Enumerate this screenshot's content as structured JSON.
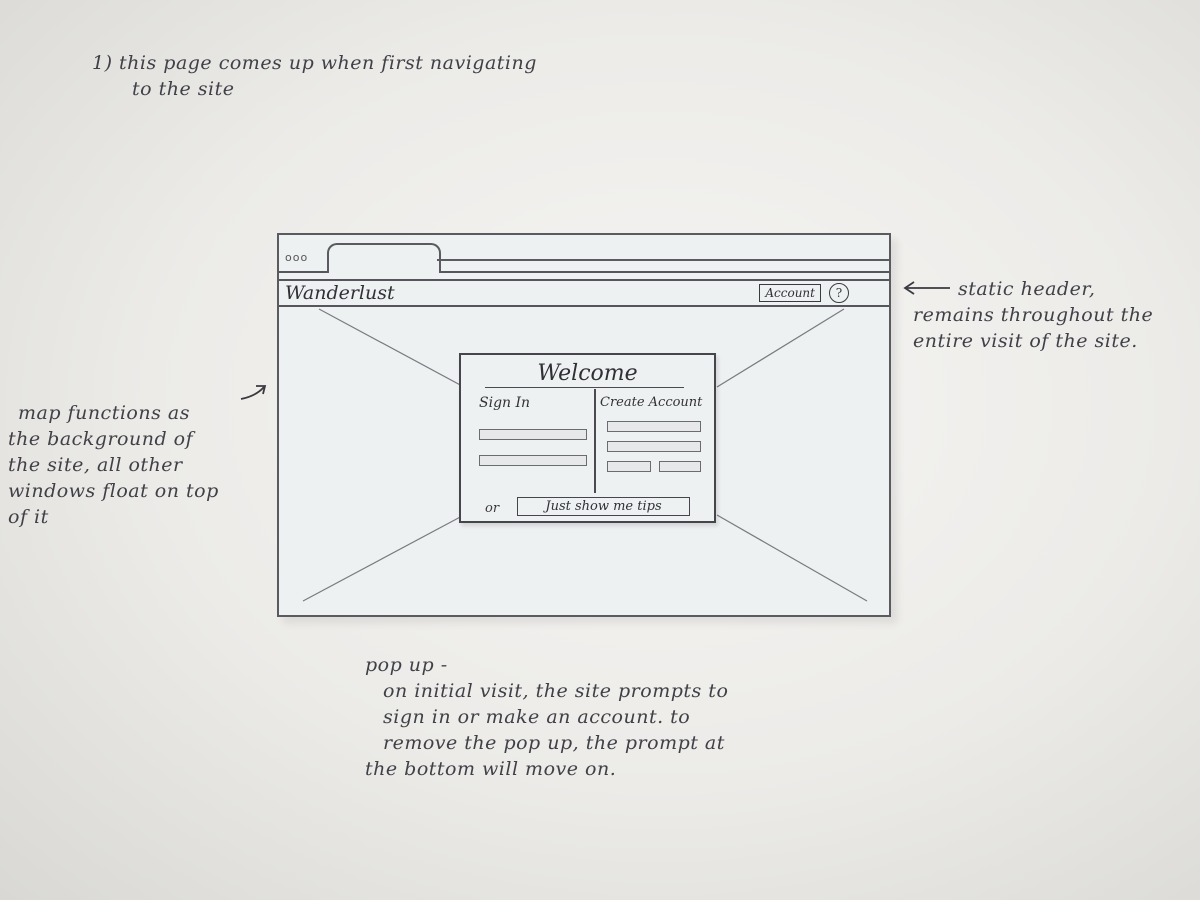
{
  "annotations": {
    "intro": [
      "1) this page comes up when first navigating",
      "to the site"
    ],
    "header_note": [
      "static header,",
      "remains throughout the",
      "entire visit of the site."
    ],
    "map_note": [
      "map functions as",
      "the background of",
      "the site, all other",
      "windows float on top",
      "of it"
    ],
    "popup_note": [
      "pop up -",
      "on initial visit, the site prompts to",
      "sign in or make an account. to",
      "remove the pop up, the prompt at",
      "the bottom will move on."
    ]
  },
  "browser": {
    "window_controls_icon": "traffic-light-dots",
    "header": {
      "brand": "Wanderlust",
      "account_label": "Account",
      "help_symbol": "?"
    }
  },
  "popup": {
    "title": "Welcome",
    "sign_in_label": "Sign In",
    "create_account_label": "Create Account",
    "or_text": "or",
    "tips_button_label": "Just show me tips"
  }
}
